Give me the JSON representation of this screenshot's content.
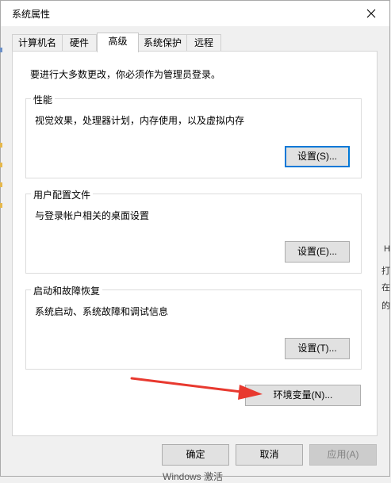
{
  "window": {
    "title": "系统属性"
  },
  "tabs": [
    {
      "label": "计算机名"
    },
    {
      "label": "硬件"
    },
    {
      "label": "高级"
    },
    {
      "label": "系统保护"
    },
    {
      "label": "远程"
    }
  ],
  "active_tab": "高级",
  "advanced": {
    "admin_note": "要进行大多数更改，你必须作为管理员登录。",
    "performance": {
      "title": "性能",
      "description": "视觉效果，处理器计划，内存使用，以及虚拟内存",
      "button": "设置(S)..."
    },
    "user_profiles": {
      "title": "用户配置文件",
      "description": "与登录帐户相关的桌面设置",
      "button": "设置(E)..."
    },
    "startup_recovery": {
      "title": "启动和故障恢复",
      "description": "系统启动、系统故障和调试信息",
      "button": "设置(T)..."
    },
    "env_button": "环境变量(N)..."
  },
  "footer": {
    "ok": "确定",
    "cancel": "取消",
    "apply": "应用(A)"
  },
  "background_peek": {
    "bottom_text": "Windows 激活",
    "right_glyphs": [
      "H",
      "打",
      "在",
      "的"
    ]
  },
  "colors": {
    "annotation_arrow": "#e8392f",
    "focus_border": "#0078d7"
  }
}
